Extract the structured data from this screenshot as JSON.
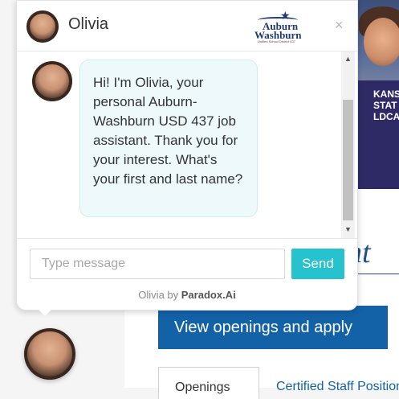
{
  "chat": {
    "agent_name": "Olivia",
    "logo": {
      "line1": "Auburn",
      "line2": "Washburn",
      "sub": "Unified School District 437"
    },
    "close_glyph": "×",
    "message": "Hi! I'm Olivia, your personal Auburn-Washburn USD 437 job assistant. Thank you for your interest. What's your first and last name?",
    "input_placeholder": "Type message",
    "send_label": "Send",
    "powered_prefix": "Olivia by ",
    "powered_brand": "Paradox.Ai"
  },
  "page": {
    "heading_fragment": "nt",
    "cta_label": "View openings and apply",
    "tab_label": "Openings",
    "link_label": "Certified Staff Positions",
    "photo_text": "KANS STAT LDCA"
  },
  "icons": {
    "close": "close-icon",
    "scroll_up": "scroll-up-icon",
    "scroll_down": "scroll-down-icon",
    "star": "star-icon"
  },
  "colors": {
    "send_button": "#26c2cd",
    "bubble": "#eef9fb",
    "cta": "#1361a6",
    "heading": "#1f4e8c"
  }
}
